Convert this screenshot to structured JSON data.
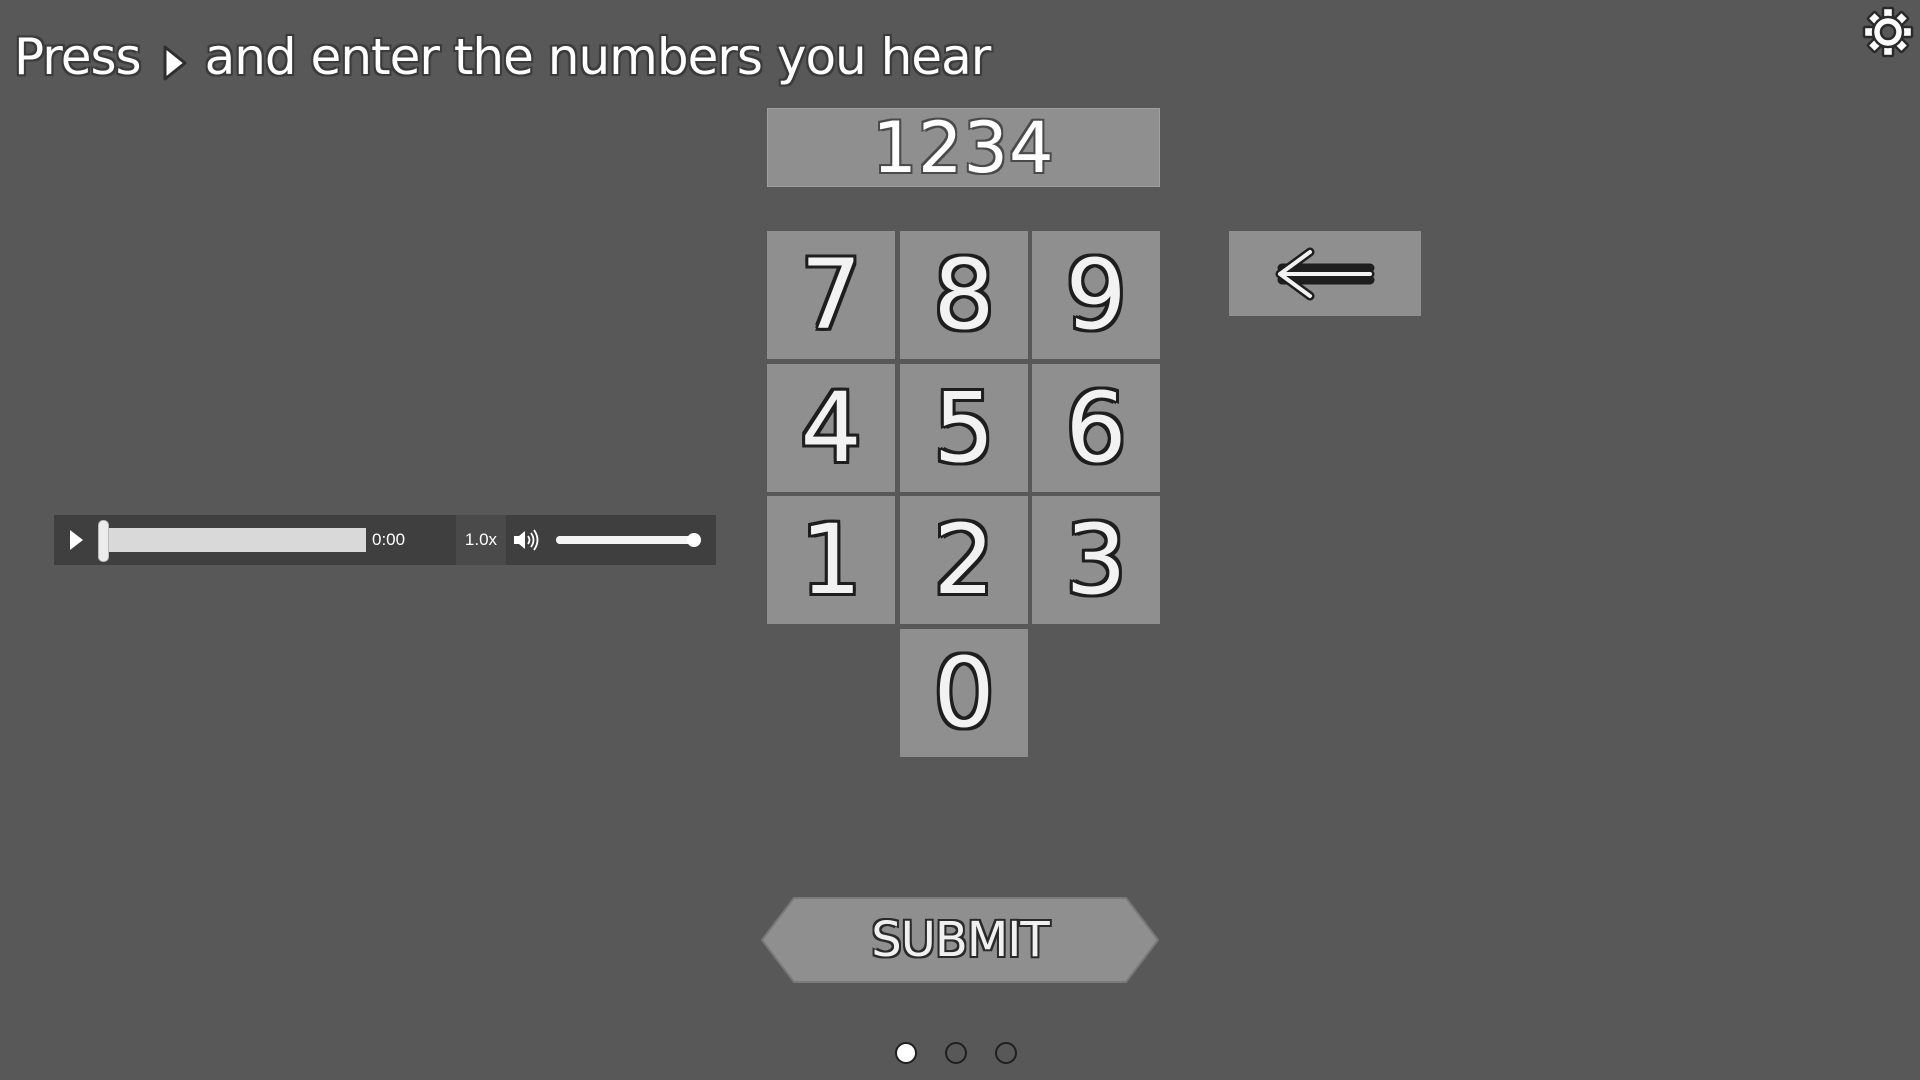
{
  "instruction": {
    "before": "Press",
    "after": "and enter the numbers you hear",
    "icon": "play-icon"
  },
  "settings": {
    "icon": "gear-icon"
  },
  "display": {
    "value": "1234"
  },
  "keypad": {
    "keys": [
      "7",
      "8",
      "9",
      "4",
      "5",
      "6",
      "1",
      "2",
      "3",
      "0"
    ],
    "backspace_icon": "left-arrow-icon"
  },
  "player": {
    "play_icon": "play-icon",
    "progress": 0,
    "time": "0:00",
    "speed": "1.0x",
    "volume_icon": "speaker-icon",
    "volume": 1.0
  },
  "submit": {
    "label": "SUBMIT"
  },
  "pagination": {
    "total": 3,
    "current": 1
  },
  "colors": {
    "background": "#585858",
    "key": "#8f8f8f",
    "player": "#3f3f3f"
  }
}
